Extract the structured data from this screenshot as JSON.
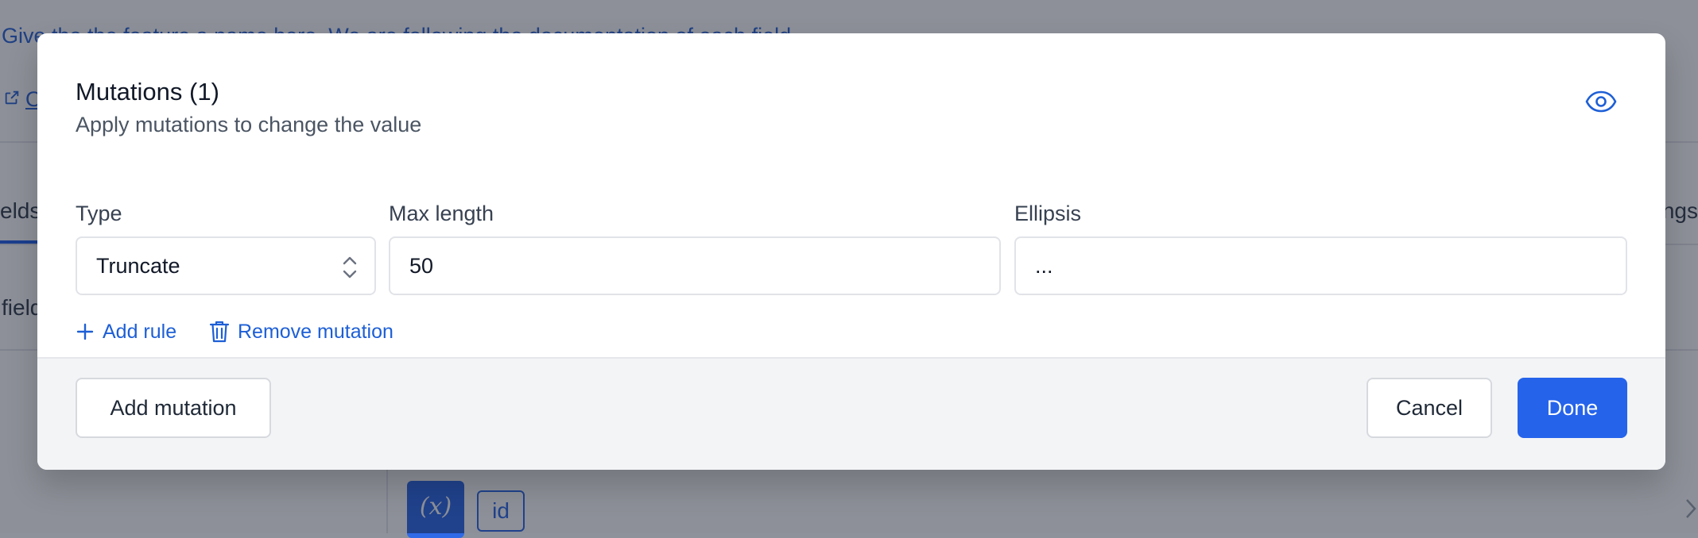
{
  "background": {
    "intro_text": "Give the the feature a name here. We are following the documentation of each field",
    "docs_link": "O",
    "tab_left": "elds",
    "tab_right": "ings",
    "fields_text": "field",
    "variable_button": "(x)",
    "id_chip": "id"
  },
  "modal": {
    "title": "Mutations (1)",
    "subtitle": "Apply mutations to change the value",
    "preview_icon": "eye-icon",
    "fields": {
      "type": {
        "label": "Type",
        "value": "Truncate"
      },
      "max_length": {
        "label": "Max length",
        "value": "50"
      },
      "ellipsis": {
        "label": "Ellipsis",
        "value": "..."
      }
    },
    "actions": {
      "add_rule": "Add rule",
      "remove_mutation": "Remove mutation"
    },
    "footer": {
      "add_mutation": "Add mutation",
      "cancel": "Cancel",
      "done": "Done"
    }
  },
  "colors": {
    "accent": "#2563eb",
    "link": "#1d5fd6",
    "overlay": "rgba(17,24,39,0.48)"
  }
}
